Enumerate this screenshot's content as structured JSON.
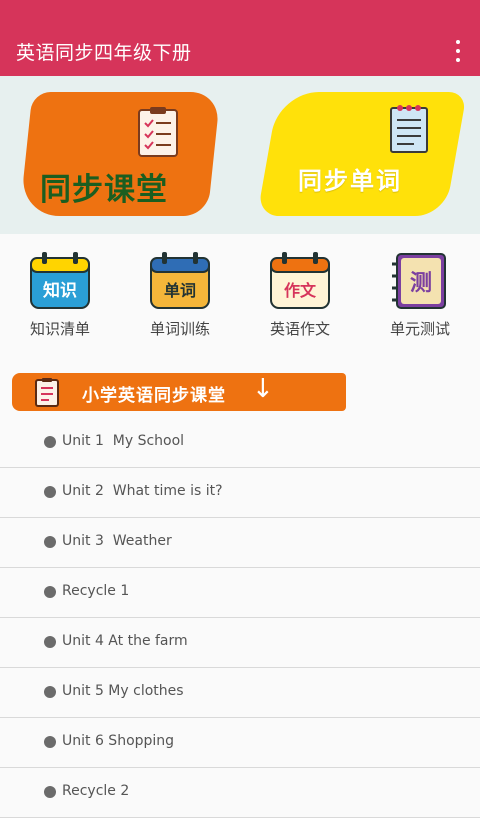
{
  "appbar": {
    "title": "英语同步四年级下册",
    "menu_icon": "more-vert-icon"
  },
  "banner": {
    "left_card": {
      "label": "同步课堂",
      "color": "#ee7211",
      "icon": "checklist-icon"
    },
    "right_card": {
      "label": "同步单词",
      "color": "#ffe10a",
      "icon": "notepad-icon"
    }
  },
  "quick_links": [
    {
      "icon_text": "知识",
      "label": "知识清单",
      "icon": "calendar-icon"
    },
    {
      "icon_text": "单词",
      "label": "单词训练",
      "icon": "calendar-icon"
    },
    {
      "icon_text": "作文",
      "label": "英语作文",
      "icon": "calendar-icon"
    },
    {
      "icon_text": "测",
      "label": "单元测试",
      "icon": "notebook-icon"
    }
  ],
  "section": {
    "title": "小学英语同步课堂",
    "arrow": "↓",
    "color": "#ee7211"
  },
  "units": [
    "Unit 1  My School",
    "Unit 2  What time is it?",
    "Unit 3  Weather",
    "Recycle 1",
    "Unit 4 At the farm",
    "Unit 5 My clothes",
    "Unit 6 Shopping",
    "Recycle 2"
  ]
}
